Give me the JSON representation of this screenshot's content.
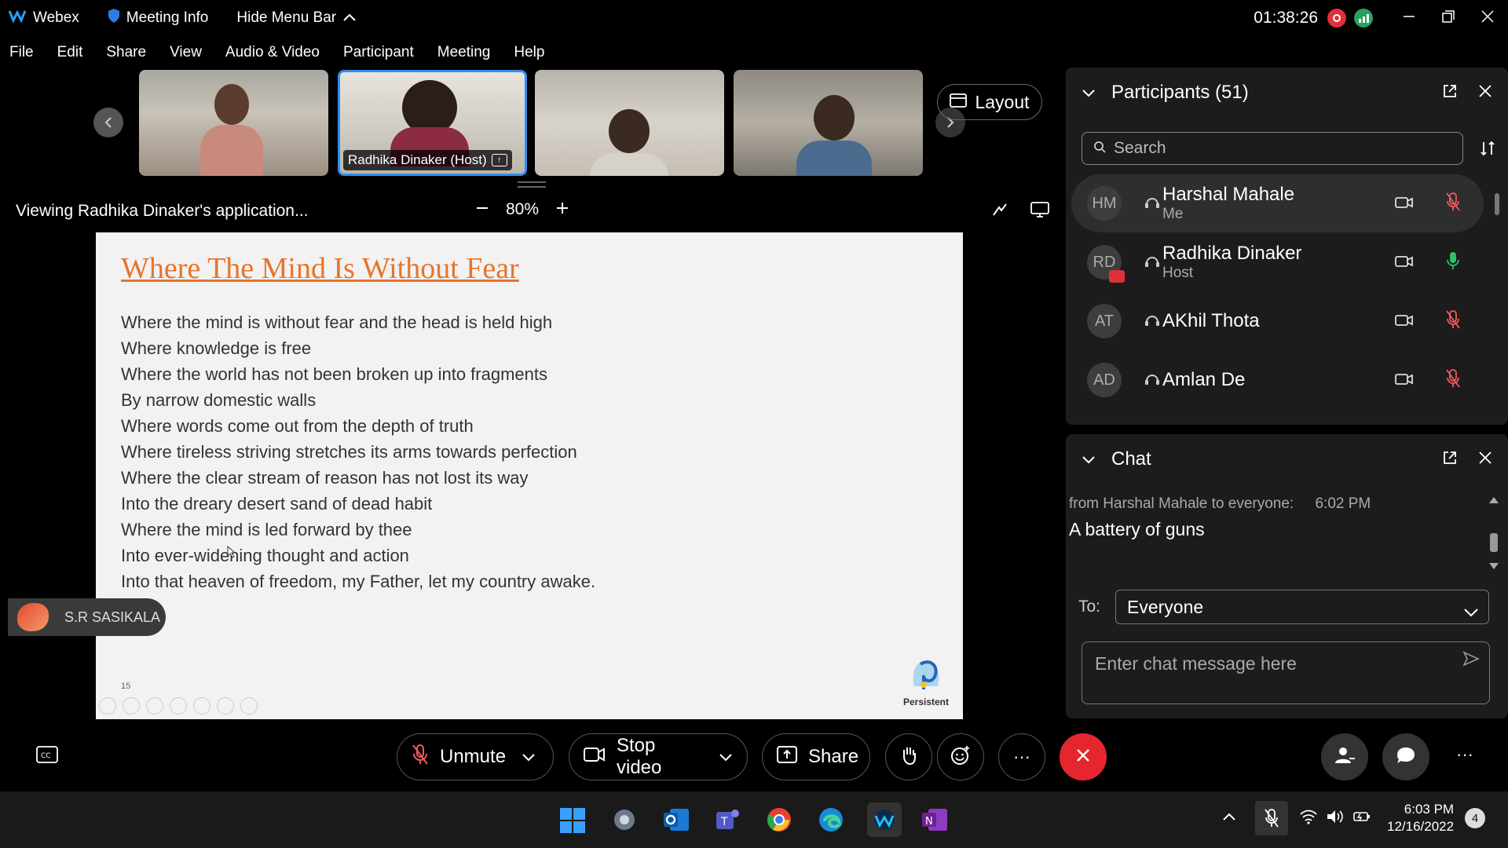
{
  "titlebar": {
    "app_name": "Webex",
    "meeting_info": "Meeting Info",
    "hide_menu_bar": "Hide Menu Bar",
    "time": "01:38:26"
  },
  "menu": [
    "File",
    "Edit",
    "Share",
    "View",
    "Audio & Video",
    "Participant",
    "Meeting",
    "Help"
  ],
  "thumbnails": [
    {
      "label": ""
    },
    {
      "label": "Radhika Dinaker (Host)"
    },
    {
      "label": ""
    },
    {
      "label": ""
    }
  ],
  "layout_label": "Layout",
  "viewing": {
    "text": "Viewing Radhika Dinaker's application...",
    "zoom": "80%"
  },
  "slide": {
    "title": "Where The Mind Is Without Fear",
    "lines": [
      "Where the mind is without fear and the head is held high",
      "Where knowledge is free",
      "Where the world has not been broken up into fragments",
      "By narrow domestic walls",
      "Where words come out from the depth of truth",
      "Where tireless striving stretches its arms towards perfection",
      "Where the clear stream of reason has not lost its way",
      "Into the dreary desert sand of dead habit",
      "Where the mind is led forward by thee",
      "Into ever-widening thought and action",
      "Into that heaven of freedom, my Father, let my country awake."
    ],
    "page_number": "15",
    "logo_text": "Persistent"
  },
  "speaker_tag": "S.R SASIKALA",
  "participants": {
    "title": "Participants (51)",
    "search_placeholder": "Search",
    "list": [
      {
        "initials": "HM",
        "name": "Harshal Mahale",
        "role": "Me"
      },
      {
        "initials": "RD",
        "name": "Radhika Dinaker",
        "role": "Host"
      },
      {
        "initials": "AT",
        "name": "AKhil Thota",
        "role": ""
      },
      {
        "initials": "AD",
        "name": "Amlan De",
        "role": ""
      }
    ]
  },
  "chat": {
    "title": "Chat",
    "message_from": "from Harshal Mahale to everyone:",
    "message_time": "6:02 PM",
    "message_text": "A battery of guns",
    "to_label": "To:",
    "to_value": "Everyone",
    "input_placeholder": "Enter chat message here"
  },
  "controls": {
    "unmute": "Unmute",
    "stop_video": "Stop video",
    "share": "Share"
  },
  "taskbar": {
    "time": "6:03 PM",
    "date": "12/16/2022",
    "notification_count": "4"
  },
  "colors": {
    "accent_orange": "#e8742a",
    "end_red": "#e5262e",
    "background": "#000000",
    "panel": "#1c1c1c"
  }
}
